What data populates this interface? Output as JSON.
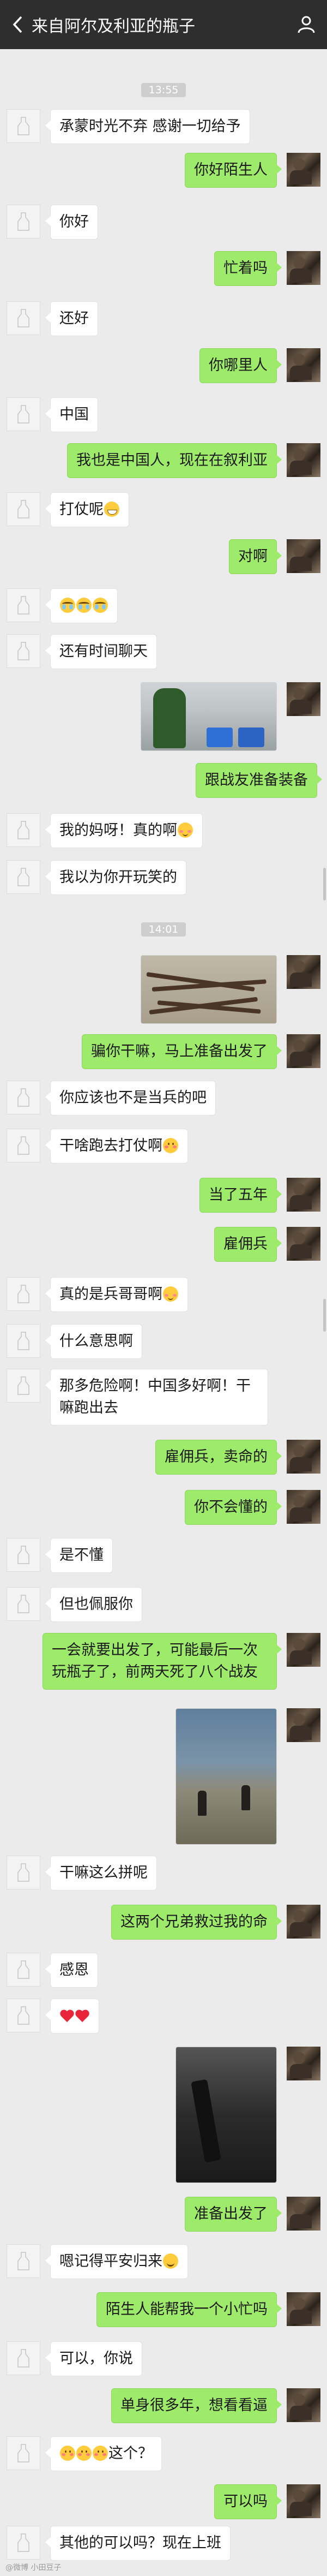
{
  "header": {
    "title": "来自阿尔及利亚的瓶子",
    "back_icon": "chevron-left-icon",
    "profile_icon": "person-icon"
  },
  "timestamps": [
    "13:55",
    "14:01"
  ],
  "messages": [
    {
      "side": "left",
      "text": "承蒙时光不弃  感谢一切给予"
    },
    {
      "side": "right",
      "text": "你好陌生人"
    },
    {
      "side": "left",
      "text": "你好"
    },
    {
      "side": "right",
      "text": "忙着吗"
    },
    {
      "side": "left",
      "text": "还好"
    },
    {
      "side": "right",
      "text": "你哪里人"
    },
    {
      "side": "left",
      "text": "中国"
    },
    {
      "side": "right",
      "text": "我也是中国人，现在在叙利亚"
    },
    {
      "side": "left",
      "text": "打仗呢"
    },
    {
      "side": "right",
      "text": "对啊"
    },
    {
      "side": "left",
      "text": ""
    },
    {
      "side": "left",
      "text": "还有时间聊天"
    },
    {
      "side": "right",
      "text": "跟战友准备装备"
    },
    {
      "side": "left",
      "text": "我的妈呀！真的啊"
    },
    {
      "side": "left",
      "text": "我以为你开玩笑的"
    },
    {
      "side": "right",
      "text": "骗你干嘛，马上准备出发了"
    },
    {
      "side": "left",
      "text": "你应该也不是当兵的吧"
    },
    {
      "side": "left",
      "text": "干啥跑去打仗啊"
    },
    {
      "side": "right",
      "text": "当了五年"
    },
    {
      "side": "right",
      "text": "雇佣兵"
    },
    {
      "side": "left",
      "text": "真的是兵哥哥啊"
    },
    {
      "side": "left",
      "text": "什么意思啊"
    },
    {
      "side": "left",
      "text": "那多危险啊！中国多好啊！干嘛跑出去"
    },
    {
      "side": "right",
      "text": "雇佣兵，卖命的"
    },
    {
      "side": "right",
      "text": "你不会懂的"
    },
    {
      "side": "left",
      "text": "是不懂"
    },
    {
      "side": "left",
      "text": "但也佩服你"
    },
    {
      "side": "right",
      "text": "一会就要出发了，可能最后一次玩瓶子了，前两天死了八个战友"
    },
    {
      "side": "left",
      "text": "干嘛这么拼呢"
    },
    {
      "side": "right",
      "text": "这两个兄弟救过我的命"
    },
    {
      "side": "left",
      "text": "感恩"
    },
    {
      "side": "left",
      "text": ""
    },
    {
      "side": "right",
      "text": "准备出发了"
    },
    {
      "side": "left",
      "text": "嗯记得平安归来"
    },
    {
      "side": "right",
      "text": "陌生人能帮我一个小忙吗"
    },
    {
      "side": "left",
      "text": "可以，你说"
    },
    {
      "side": "right",
      "text": "单身很多年，想看看逼"
    },
    {
      "side": "left",
      "text": "这个？"
    },
    {
      "side": "right",
      "text": "可以吗"
    },
    {
      "side": "left",
      "text": "其他的可以吗？现在上班"
    }
  ],
  "watermark": "@微博 小田豆子"
}
